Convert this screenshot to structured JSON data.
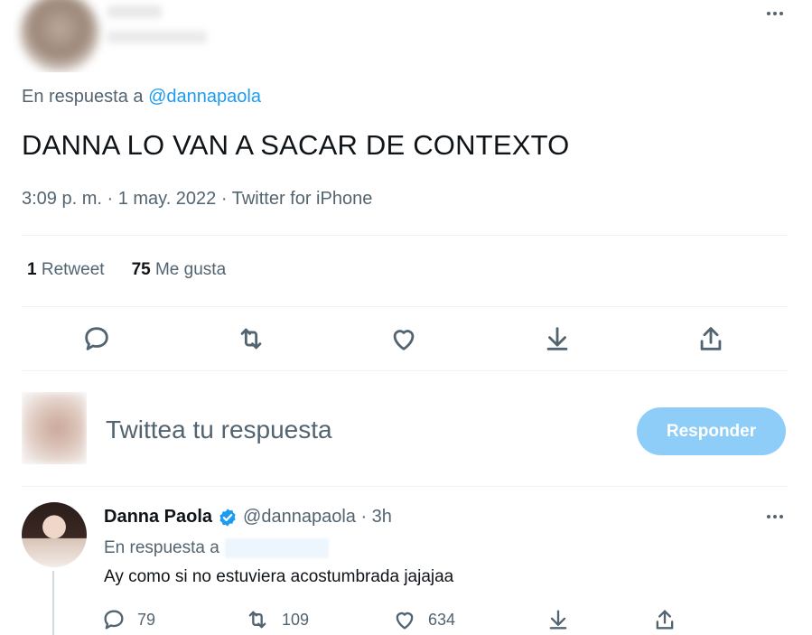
{
  "main_tweet": {
    "reply_prefix": "En respuesta a",
    "reply_handle": "@dannapaola",
    "text": "DANNA LO VAN A SACAR DE CONTEXTO",
    "meta": "3:09 p. m. · 1 may. 2022 · Twitter for iPhone",
    "stats": {
      "retweet_count": "1",
      "retweet_label": "Retweet",
      "like_count": "75",
      "like_label": "Me gusta"
    },
    "icons": [
      "reply-icon",
      "retweet-icon",
      "like-icon",
      "download-icon",
      "share-icon"
    ]
  },
  "composer": {
    "placeholder": "Twittea tu respuesta",
    "button_label": "Responder"
  },
  "reply_tweet": {
    "name": "Danna Paola",
    "handle_time": "@dannapaola · 3h",
    "reply_prefix": "En respuesta a",
    "text": "Ay como si no estuviera acostumbrada jajajaa",
    "reply_count": "79",
    "retweet_count": "109",
    "like_count": "634"
  },
  "colors": {
    "accent": "#1d9bf0",
    "button_disabled": "#8ecdf8",
    "secondary_text": "#536471",
    "divider": "#eff3f4"
  }
}
